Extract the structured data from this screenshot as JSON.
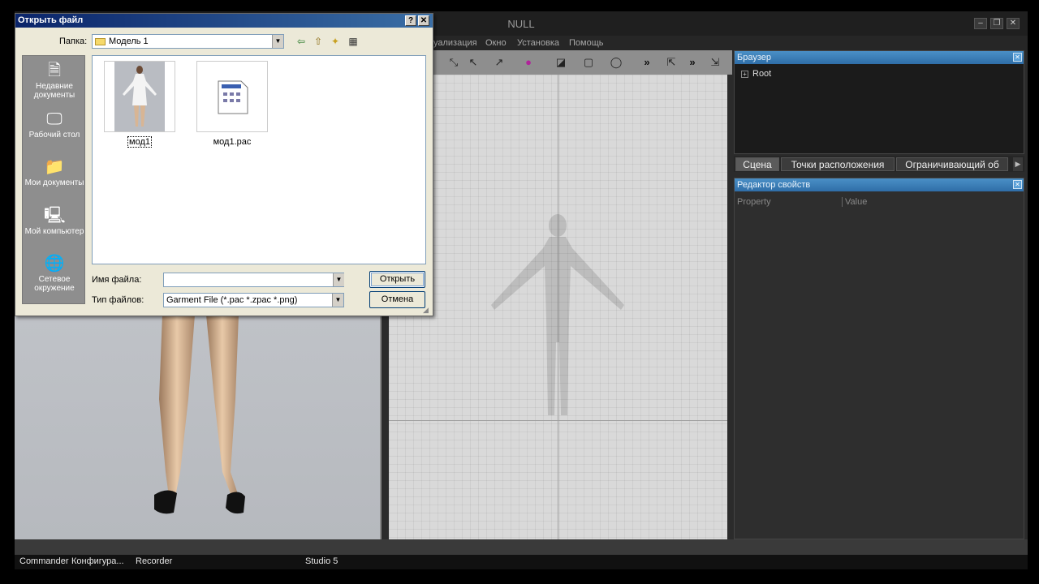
{
  "app": {
    "title": "NULL",
    "menu": [
      "уализация",
      "Окно",
      "Установка",
      "Помощь"
    ]
  },
  "right_panel": {
    "browser_title": "Браузер",
    "tree_root": "Root",
    "tabs": [
      "Сцена",
      "Точки расположения",
      "Ограничивающий об"
    ],
    "properties_title": "Редактор свойств",
    "col_property": "Property",
    "col_value": "Value"
  },
  "taskbar": [
    "Commander",
    "Конфигура...",
    "Recorder",
    "Studio 5"
  ],
  "dialog": {
    "title": "Открыть файл",
    "folder_label": "Папка:",
    "folder_value": "Модель 1",
    "places": [
      "Недавние документы",
      "Рабочий стол",
      "Мои документы",
      "Мой компьютер",
      "Сетевое окружение"
    ],
    "files": [
      "мод1",
      "мод1.pac"
    ],
    "filename_label": "Имя файла:",
    "filename_value": "",
    "filetype_label": "Тип файлов:",
    "filetype_value": "Garment File (*.pac *.zpac *.png)",
    "open_label": "Открыть",
    "cancel_label": "Отмена"
  }
}
